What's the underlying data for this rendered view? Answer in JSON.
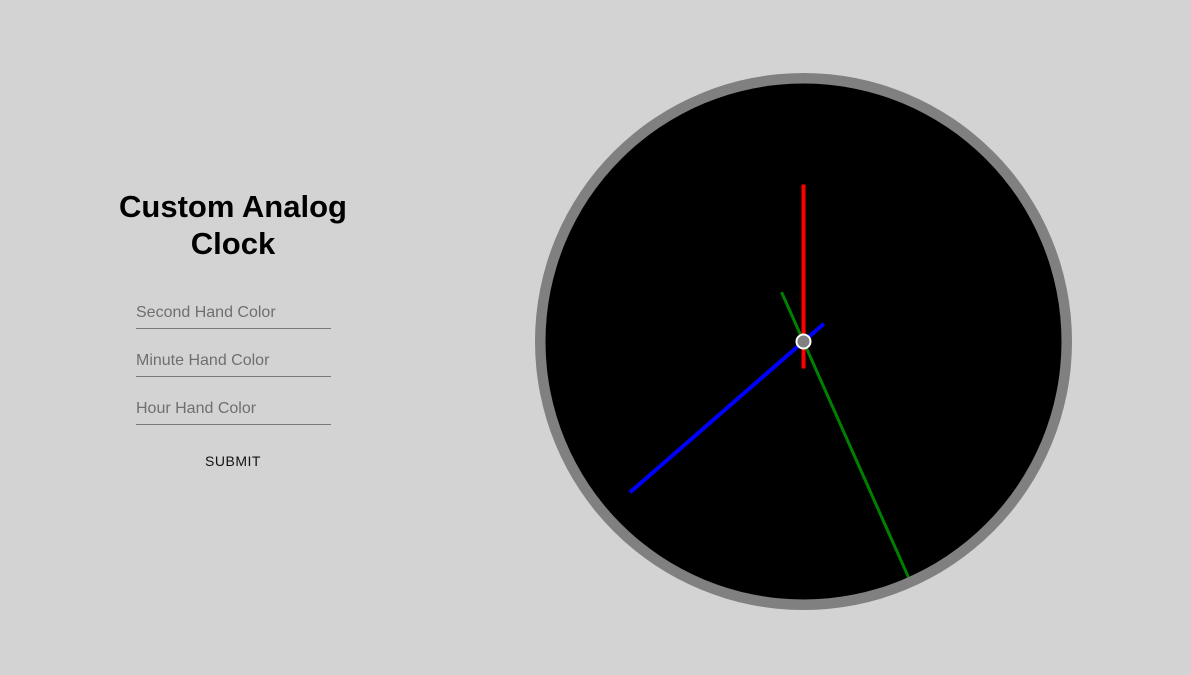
{
  "title": "Custom Analog Clock",
  "form": {
    "second_placeholder": "Second Hand Color",
    "minute_placeholder": "Minute Hand Color",
    "hour_placeholder": "Hour Hand Color",
    "submit_label": "SUBMIT"
  },
  "clock": {
    "face_color": "#000000",
    "rim_color": "#808080",
    "center_color": "#808080",
    "second_hand": {
      "color": "#ff0000",
      "angle_deg": 0
    },
    "minute_hand": {
      "color": "#008000",
      "angle_deg": 156
    },
    "hour_hand": {
      "color": "#0000ff",
      "angle_deg": 229
    }
  }
}
